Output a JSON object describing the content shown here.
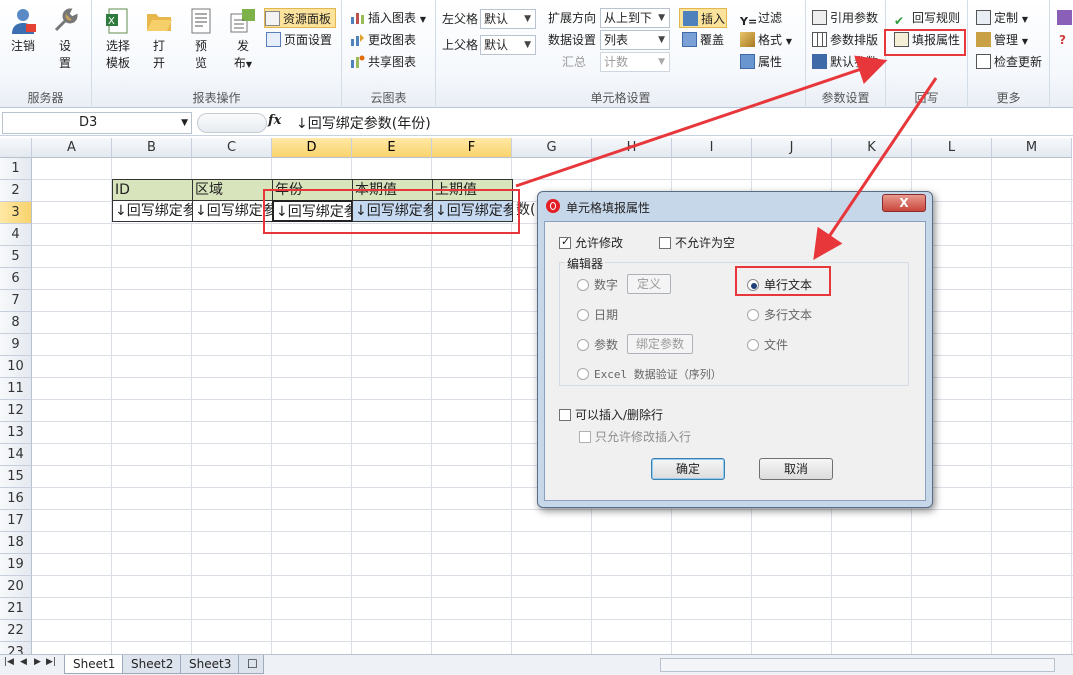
{
  "ribbon": {
    "groups": {
      "server": "服务器",
      "report_ops": "报表操作",
      "cloud_chart": "云图表",
      "cell_settings": "单元格设置",
      "param_settings": "参数设置",
      "writeback": "回写",
      "more": "更多"
    },
    "logout": "注销",
    "settings": "设\n置",
    "select_template": "选择\n模板",
    "open": "打\n开",
    "preview": "预\n览",
    "publish": "发\n布",
    "resource_panel": "资源面板",
    "page_setup": "页面设置",
    "insert_chart": "插入图表",
    "change_chart": "更改图表",
    "share_chart": "共享图表",
    "left_parent_label": "左父格",
    "left_parent_value": "默认",
    "top_parent_label": "上父格",
    "top_parent_value": "默认",
    "expand_dir_label": "扩展方向",
    "expand_dir_value": "从上到下",
    "data_setting_label": "数据设置",
    "data_setting_value": "列表",
    "summary_label": "汇总",
    "summary_value": "计数",
    "insert": "插入",
    "cover": "覆盖",
    "filter": "过滤",
    "format": "格式",
    "property": "属性",
    "ref_param": "引用参数",
    "param_layout": "参数排版",
    "default_param": "默认参数",
    "writeback_rule": "回写规则",
    "fill_property": "填报属性",
    "customize": "定制",
    "manage": "管理",
    "check_update": "检查更新"
  },
  "formula": {
    "cell_ref": "D3",
    "fx": "fx",
    "value": "↓回写绑定参数(年份)"
  },
  "grid": {
    "columns": [
      "A",
      "B",
      "C",
      "D",
      "E",
      "F",
      "G",
      "H",
      "I",
      "J",
      "K",
      "L",
      "M"
    ],
    "rows": [
      "1",
      "2",
      "3",
      "4",
      "5",
      "6",
      "7",
      "8",
      "9",
      "10",
      "11",
      "12",
      "13",
      "14",
      "15",
      "16",
      "17",
      "18",
      "19",
      "20",
      "21",
      "22",
      "23"
    ],
    "headers": [
      "ID",
      "区域",
      "年份",
      "本期值",
      "上期值"
    ],
    "data": [
      "↓回写绑定参",
      "↓回写绑定参",
      "↓回写绑定参",
      "↓回写绑定参",
      "↓回写绑定参"
    ],
    "overflow_text": "数("
  },
  "sheets": [
    "Sheet1",
    "Sheet2",
    "Sheet3"
  ],
  "dialog": {
    "title": "单元格填报属性",
    "close": "X",
    "allow_edit": "允许修改",
    "not_null": "不允许为空",
    "editor_legend": "编辑器",
    "opt_number": "数字",
    "btn_define": "定义",
    "opt_single_text": "单行文本",
    "opt_date": "日期",
    "opt_multi_text": "多行文本",
    "opt_param": "参数",
    "btn_bind_param": "绑定参数",
    "opt_file": "文件",
    "opt_excel_validation": "Excel 数据验证（序列）",
    "allow_insert_delete": "可以插入/删除行",
    "only_edit_insert": "只允许修改插入行",
    "ok": "确定",
    "cancel": "取消"
  },
  "colors": {
    "highlight_red": "#e8373b",
    "header_green": "#d8e4bc",
    "selection_blue": "#c5d9f1"
  }
}
